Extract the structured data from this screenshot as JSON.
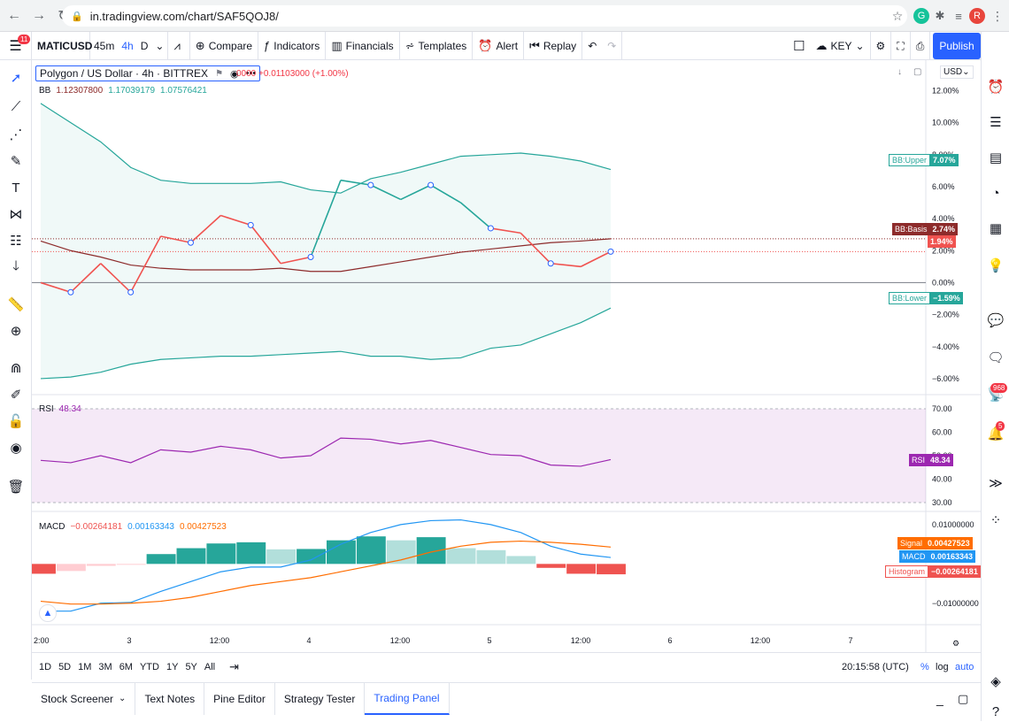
{
  "browser": {
    "url": "in.tradingview.com/chart/SAF5QOJ8/",
    "avatar": "R"
  },
  "toolbar": {
    "symbol": "MATICUSD",
    "interval_45m": "45m",
    "interval_4h": "4h",
    "interval_d": "D",
    "compare": "Compare",
    "indicators": "Indicators",
    "financials": "Financials",
    "templates": "Templates",
    "alert": "Alert",
    "replay": "Replay",
    "layout_name": "KEY",
    "publish": "Publish",
    "menu_badge": "11"
  },
  "legend": {
    "title": "Polygon / US Dollar · 4h · BITTREX",
    "change": "0000 +0.01103000 (+1.00%)",
    "bb_label": "BB",
    "bb_values": [
      "1.12307800",
      "1.17039179",
      "1.07576421"
    ]
  },
  "currency": "USD",
  "price_axis": [
    "12.00%",
    "10.00%",
    "8.00%",
    "6.00%",
    "4.00%",
    "2.00%",
    "0.00%",
    "−2.00%",
    "−4.00%",
    "−6.00%"
  ],
  "tags": {
    "bb_upper": {
      "name": "BB:Upper",
      "value": "7.07%"
    },
    "bb_basis": {
      "name": "BB:Basis",
      "value": "2.74%"
    },
    "last": {
      "value": "1.94%"
    },
    "bb_lower": {
      "name": "BB:Lower",
      "value": "−1.59%"
    },
    "rsi": {
      "name": "RSI",
      "value": "48.34"
    },
    "signal": {
      "name": "Signal",
      "value": "0.00427523"
    },
    "macd": {
      "name": "MACD",
      "value": "0.00163343"
    },
    "histogram": {
      "name": "Histogram",
      "value": "−0.00264181"
    }
  },
  "rsi": {
    "label": "RSI",
    "value": "48.34",
    "axis": [
      "70.00",
      "60.00",
      "50.00",
      "40.00",
      "30.00"
    ]
  },
  "macd": {
    "label": "MACD",
    "values": [
      "−0.00264181",
      "0.00163343",
      "0.00427523"
    ],
    "axis": [
      "0.01000000",
      "−0.01000000"
    ]
  },
  "time_axis": [
    "2:00",
    "3",
    "12:00",
    "4",
    "12:00",
    "5",
    "12:00",
    "6",
    "12:00",
    "7"
  ],
  "range_buttons": [
    "1D",
    "5D",
    "1M",
    "3M",
    "6M",
    "YTD",
    "1Y",
    "5Y",
    "All"
  ],
  "clock": "20:15:58 (UTC)",
  "scale_opts": {
    "pct": "%",
    "log": "log",
    "auto": "auto"
  },
  "bottom_tabs": [
    "Stock Screener",
    "Text Notes",
    "Pine Editor",
    "Strategy Tester",
    "Trading Panel"
  ],
  "sidebar_badges": {
    "ideas": "968",
    "notifications": "5"
  },
  "colors": {
    "accent": "#2962ff",
    "bb_band": "#26a69a",
    "bb_basis": "#8d2b2b",
    "price_down": "#f05350",
    "rsi": "#9c27b0",
    "macd_line": "#2196f3",
    "signal_line": "#ff6d00",
    "hist_up_strong": "#26a69a",
    "hist_up_weak": "#b2dfdb",
    "hist_down_strong": "#ef5350",
    "hist_down_weak": "#ffcdd2"
  },
  "chart_data": {
    "type": "line",
    "price_pct": [
      0.0,
      -0.6,
      1.2,
      -0.6,
      2.9,
      2.5,
      4.2,
      3.6,
      1.2,
      1.6,
      6.4,
      6.1,
      5.2,
      6.1,
      5.0,
      3.4,
      3.1,
      1.2,
      1.0,
      1.94
    ],
    "bb_upper_pct": [
      11.2,
      10.0,
      8.8,
      7.2,
      6.4,
      6.2,
      6.2,
      6.2,
      6.3,
      5.8,
      5.6,
      6.5,
      6.9,
      7.4,
      7.9,
      8.0,
      8.1,
      7.9,
      7.6,
      7.07
    ],
    "bb_basis_pct": [
      2.6,
      2.0,
      1.6,
      1.1,
      0.9,
      0.8,
      0.8,
      0.8,
      0.9,
      0.7,
      0.7,
      1.0,
      1.3,
      1.6,
      1.9,
      2.1,
      2.3,
      2.5,
      2.6,
      2.74
    ],
    "bb_lower_pct": [
      -6.0,
      -5.9,
      -5.6,
      -5.1,
      -4.8,
      -4.7,
      -4.6,
      -4.6,
      -4.5,
      -4.4,
      -4.3,
      -4.6,
      -4.6,
      -4.8,
      -4.7,
      -4.1,
      -3.9,
      -3.2,
      -2.5,
      -1.59
    ],
    "rsi": [
      48.0,
      47.0,
      50.0,
      47.0,
      52.5,
      51.5,
      54.0,
      52.5,
      49.0,
      50.0,
      57.5,
      57.0,
      55.0,
      56.5,
      53.5,
      50.5,
      50.0,
      46.0,
      45.5,
      48.34
    ],
    "macd": [
      -0.012,
      -0.012,
      -0.01,
      -0.0098,
      -0.007,
      -0.0045,
      -0.002,
      -0.0008,
      -0.0008,
      0.001,
      0.005,
      0.008,
      0.01,
      0.011,
      0.0112,
      0.01,
      0.008,
      0.0045,
      0.0025,
      0.00163343
    ],
    "signal": [
      -0.0095,
      -0.0102,
      -0.0102,
      -0.01,
      -0.0095,
      -0.0085,
      -0.007,
      -0.0055,
      -0.0045,
      -0.0035,
      -0.002,
      -0.0005,
      0.001,
      0.003,
      0.0045,
      0.0055,
      0.0058,
      0.0055,
      0.005,
      0.00427523
    ],
    "histogram": [
      -0.0025,
      -0.0018,
      -0.0005,
      -0.0002,
      0.0025,
      0.004,
      0.0052,
      0.0055,
      0.0037,
      0.0038,
      0.006,
      0.007,
      0.006,
      0.0068,
      0.004,
      0.0035,
      0.002,
      -0.001,
      -0.0025,
      -0.00264181
    ],
    "ylim_price": [
      -7,
      12.8
    ],
    "ylim_rsi": [
      30,
      70
    ],
    "ylim_macd": [
      -0.015,
      0.012
    ]
  }
}
